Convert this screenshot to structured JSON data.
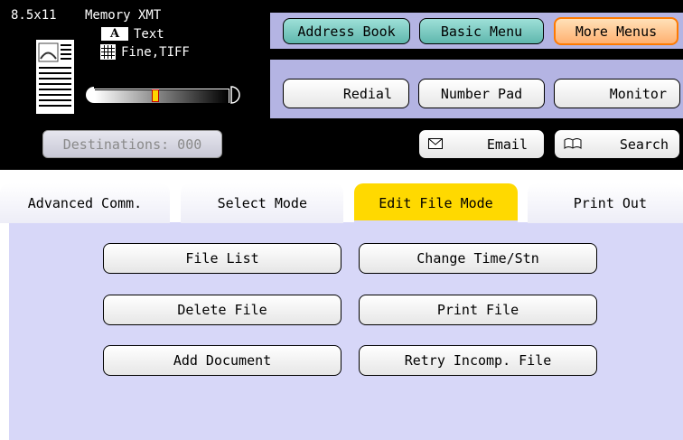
{
  "status": {
    "paper_size": "8.5x11",
    "mode": "Memory XMT",
    "text_icon": "A",
    "text_mode": "Text",
    "resolution": "Fine,TIFF",
    "contrast_low_icon": "contrast-low-icon",
    "contrast_high_icon": "contrast-high-icon",
    "contrast_level": 0.45
  },
  "destinations_button": "Destinations: 000",
  "nav": {
    "address_book": "Address Book",
    "basic_menu": "Basic Menu",
    "more_menus": "More Menus"
  },
  "functions": {
    "redial": "Redial",
    "number_pad": "Number Pad",
    "monitor": "Monitor",
    "email": "Email",
    "search": "Search"
  },
  "tabs": [
    {
      "label": "Advanced Comm."
    },
    {
      "label": "Select Mode"
    },
    {
      "label": "Edit File Mode"
    },
    {
      "label": "Print Out"
    }
  ],
  "active_tab": "Edit File Mode",
  "edit_file_buttons": {
    "file_list": "File List",
    "change_time_stn": "Change Time/Stn",
    "delete_file": "Delete File",
    "print_file": "Print File",
    "add_document": "Add Document",
    "retry_incomp_file": "Retry Incomp. File"
  },
  "colors": {
    "panel_bg": "#b4b4e3",
    "content_bg": "#d7d7f8",
    "active_tab": "#ffd900",
    "teal_button": "#5fb7ad",
    "orange_button": "#ffb070"
  }
}
